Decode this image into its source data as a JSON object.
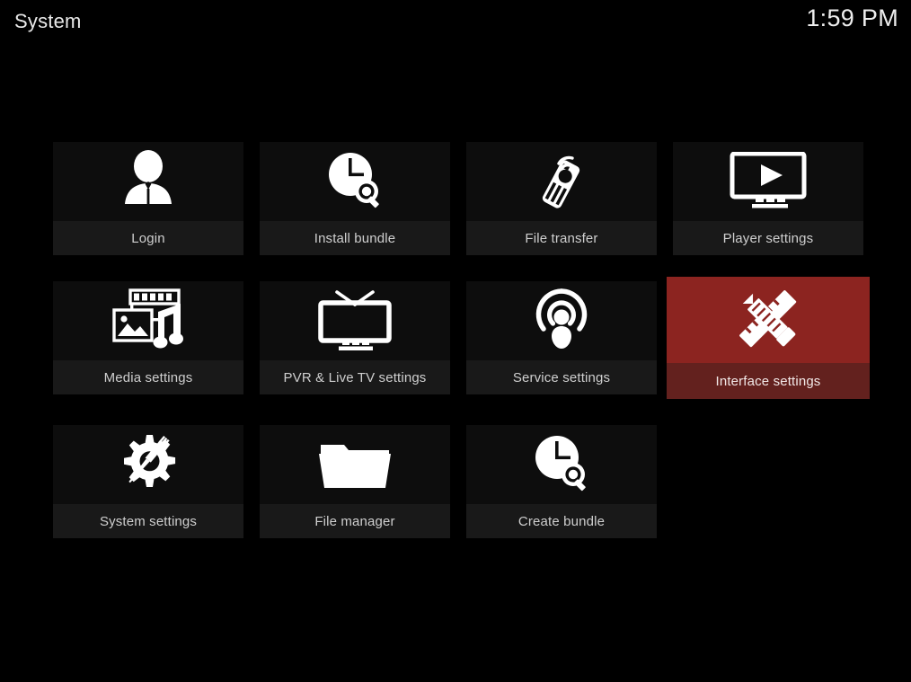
{
  "header": {
    "title": "System",
    "clock": "1:59 PM"
  },
  "theme": {
    "background": "#000000",
    "tile_background": "#0d0d0d",
    "tile_label_background": "#191919",
    "selected_background": "#8c2420",
    "selected_label_background": "#63211e",
    "text_color": "#cfcfcf",
    "header_text_color": "#e9e9e9"
  },
  "grid": {
    "columns": 4,
    "rows": [
      [
        {
          "label": "Login",
          "icon": "user-silhouette-icon",
          "selected": false
        },
        {
          "label": "Install bundle",
          "icon": "clock-search-icon",
          "selected": false
        },
        {
          "label": "File transfer",
          "icon": "remote-control-icon",
          "selected": false
        },
        {
          "label": "Player settings",
          "icon": "tv-play-icon",
          "selected": false
        }
      ],
      [
        {
          "label": "Media settings",
          "icon": "media-filmstrip-picture-note-icon",
          "selected": false
        },
        {
          "label": "PVR & Live TV settings",
          "icon": "tv-antenna-icon",
          "selected": false
        },
        {
          "label": "Service settings",
          "icon": "broadcast-podcast-icon",
          "selected": false
        },
        {
          "label": "Interface settings",
          "icon": "pencil-ruler-cross-icon",
          "selected": true
        }
      ],
      [
        {
          "label": "System settings",
          "icon": "gear-screwdriver-icon",
          "selected": false
        },
        {
          "label": "File manager",
          "icon": "folder-icon",
          "selected": false
        },
        {
          "label": "Create bundle",
          "icon": "clock-search-icon",
          "selected": false
        },
        {
          "label": "",
          "icon": "none",
          "selected": false,
          "placeholder": true
        }
      ]
    ]
  }
}
